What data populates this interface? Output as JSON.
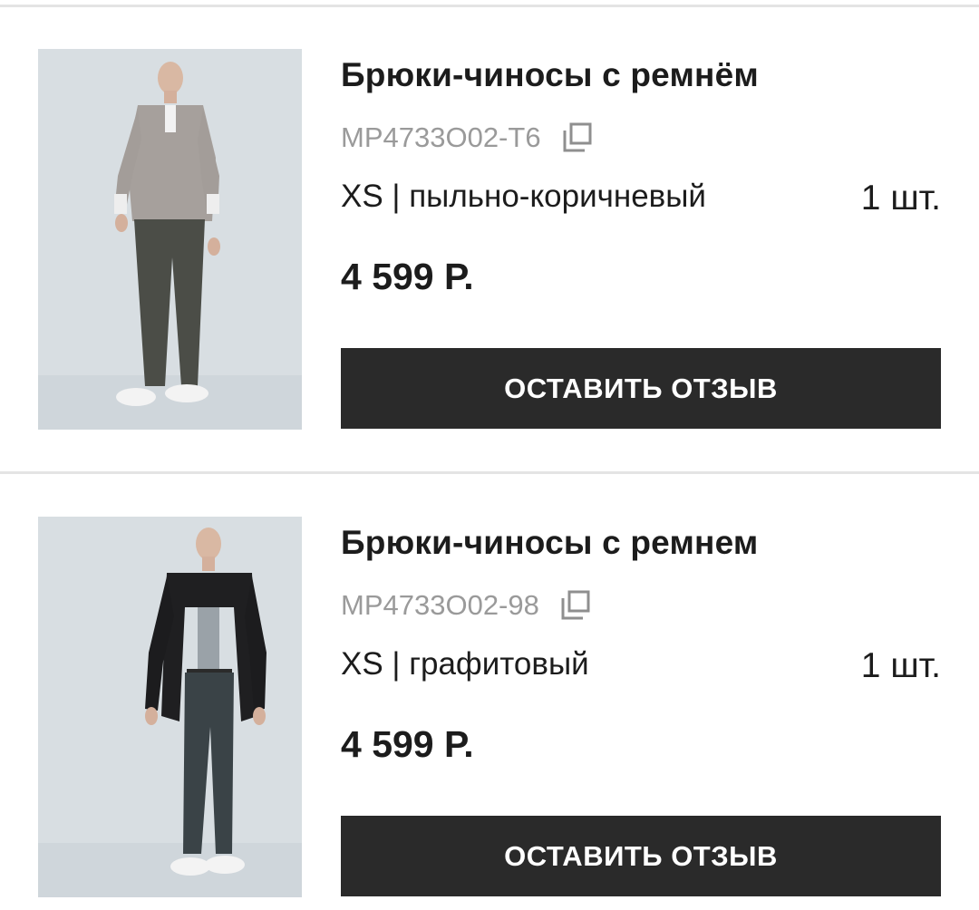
{
  "orders": [
    {
      "title": "Брюки-чиносы с ремнём",
      "sku": "MP4733O02-T6",
      "variant": "XS | пыльно-коричневый",
      "quantity": "1 шт.",
      "price": "4 599 Р.",
      "review_label": "ОСТАВИТЬ ОТЗЫВ",
      "image_subject": "man in grey zip jacket and dark trousers",
      "icons": {
        "copy": "copy-icon"
      },
      "colors": {
        "jacket": "#a6a09c",
        "trousers": "#4b4d47",
        "background": "#d7dde1"
      }
    },
    {
      "title": "Брюки-чиносы с ремнем",
      "sku": "MP4733O02-98",
      "variant": "XS | графитовый",
      "quantity": "1 шт.",
      "price": "4 599 Р.",
      "review_label": "ОСТАВИТЬ ОТЗЫВ",
      "image_subject": "man in black overshirt and graphite trousers",
      "icons": {
        "copy": "copy-icon"
      },
      "colors": {
        "jacket": "#1f1f21",
        "trousers": "#3a4347",
        "background": "#d7dde1"
      }
    }
  ],
  "theme": {
    "button_bg": "#2a2a2a",
    "button_text": "#ffffff",
    "muted_text": "#9a9a9a",
    "divider": "#e4e4e4"
  }
}
